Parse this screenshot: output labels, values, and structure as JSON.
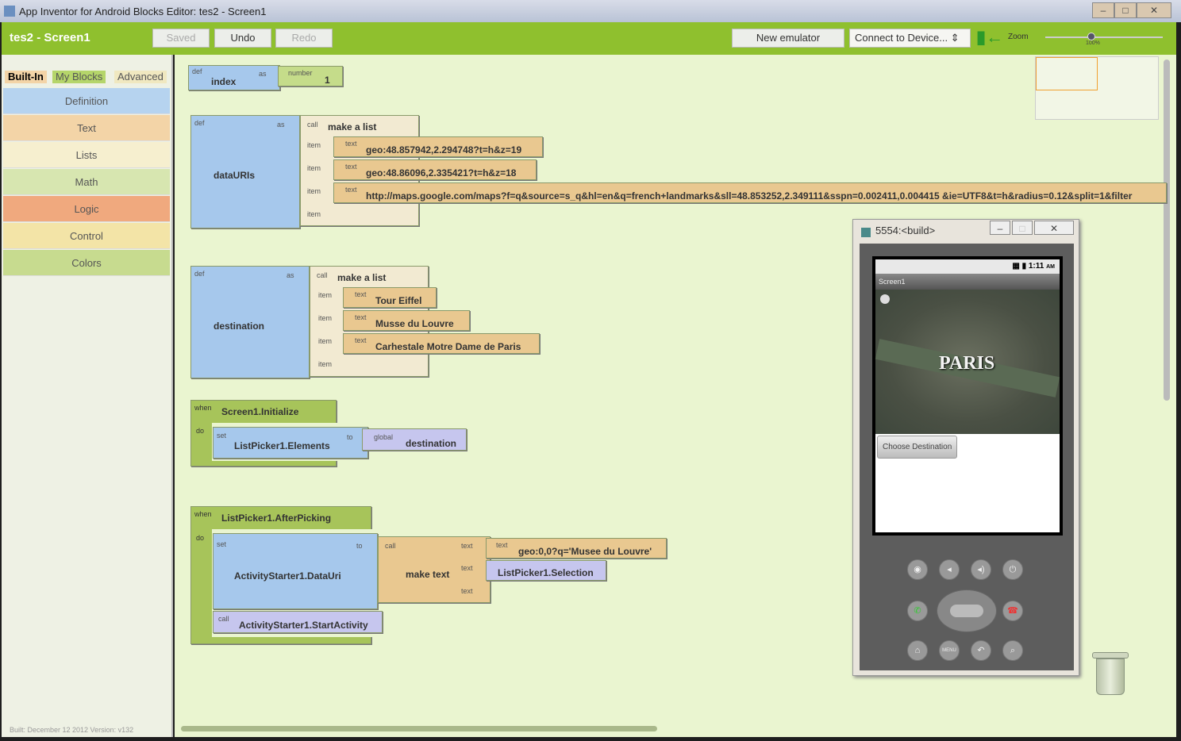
{
  "window": {
    "title": "App Inventor for Android Blocks Editor: tes2 - Screen1",
    "min": "–",
    "max": "□",
    "close": "✕"
  },
  "toolbar": {
    "project": "tes2 - Screen1",
    "saved": "Saved",
    "undo": "Undo",
    "redo": "Redo",
    "new_emulator": "New emulator",
    "connect": "Connect to Device...",
    "zoom_label": "Zoom",
    "zoom_value": "100%",
    "zoom_percent": 100
  },
  "palette": {
    "tabs": [
      "Built-In",
      "My Blocks",
      "Advanced"
    ],
    "items": [
      {
        "label": "Definition",
        "color": "#b6d3ef"
      },
      {
        "label": "Text",
        "color": "#f3d4a7"
      },
      {
        "label": "Lists",
        "color": "#f6efcf"
      },
      {
        "label": "Math",
        "color": "#d7e6b0"
      },
      {
        "label": "Logic",
        "color": "#f0a97e"
      },
      {
        "label": "Control",
        "color": "#f3e4a7"
      },
      {
        "label": "Colors",
        "color": "#c7db8f"
      }
    ],
    "footer": "Built: December 12 2012 Version: v132"
  },
  "blocks": {
    "def": "def",
    "as": "as",
    "call": "call",
    "item": "item",
    "text": "text",
    "number": "number",
    "when": "when",
    "do": "do",
    "set": "set",
    "to": "to",
    "global": "global",
    "make_a_list": "make a list",
    "make_text": "make text",
    "index": {
      "name": "index",
      "value": "1"
    },
    "dataURIs": {
      "name": "dataURIs",
      "items": [
        "geo:48.857942,2.294748?t=h&z=19",
        "geo:48.86096,2.335421?t=h&z=18",
        "http://maps.google.com/maps?f=q&source=s_q&hl=en&q=french+landmarks&sll=48.853252,2.349111&sspn=0.002411,0.004415 &ie=UTF8&t=h&radius=0.12&split=1&filter"
      ]
    },
    "destination": {
      "name": "destination",
      "items": [
        "Tour Eiffel",
        "Musse du Louvre",
        "Carhestale Motre Dame de Paris"
      ]
    },
    "init": {
      "event": "Screen1.Initialize",
      "prop": "ListPicker1.Elements",
      "global_name": "destination"
    },
    "after": {
      "event": "ListPicker1.AfterPicking",
      "prop": "ActivityStarter1.DataUri",
      "text1": "geo:0,0?q='Musee du Louvre'",
      "selection": "ListPicker1.Selection",
      "method": "ActivityStarter1.StartActivity"
    }
  },
  "emulator": {
    "title": "5554:<build>",
    "time": "1:11",
    "ampm": "AM",
    "screen_title": "Screen1",
    "map_label": "PARIS",
    "button": "Choose Destination",
    "menu_label": "MENU"
  }
}
